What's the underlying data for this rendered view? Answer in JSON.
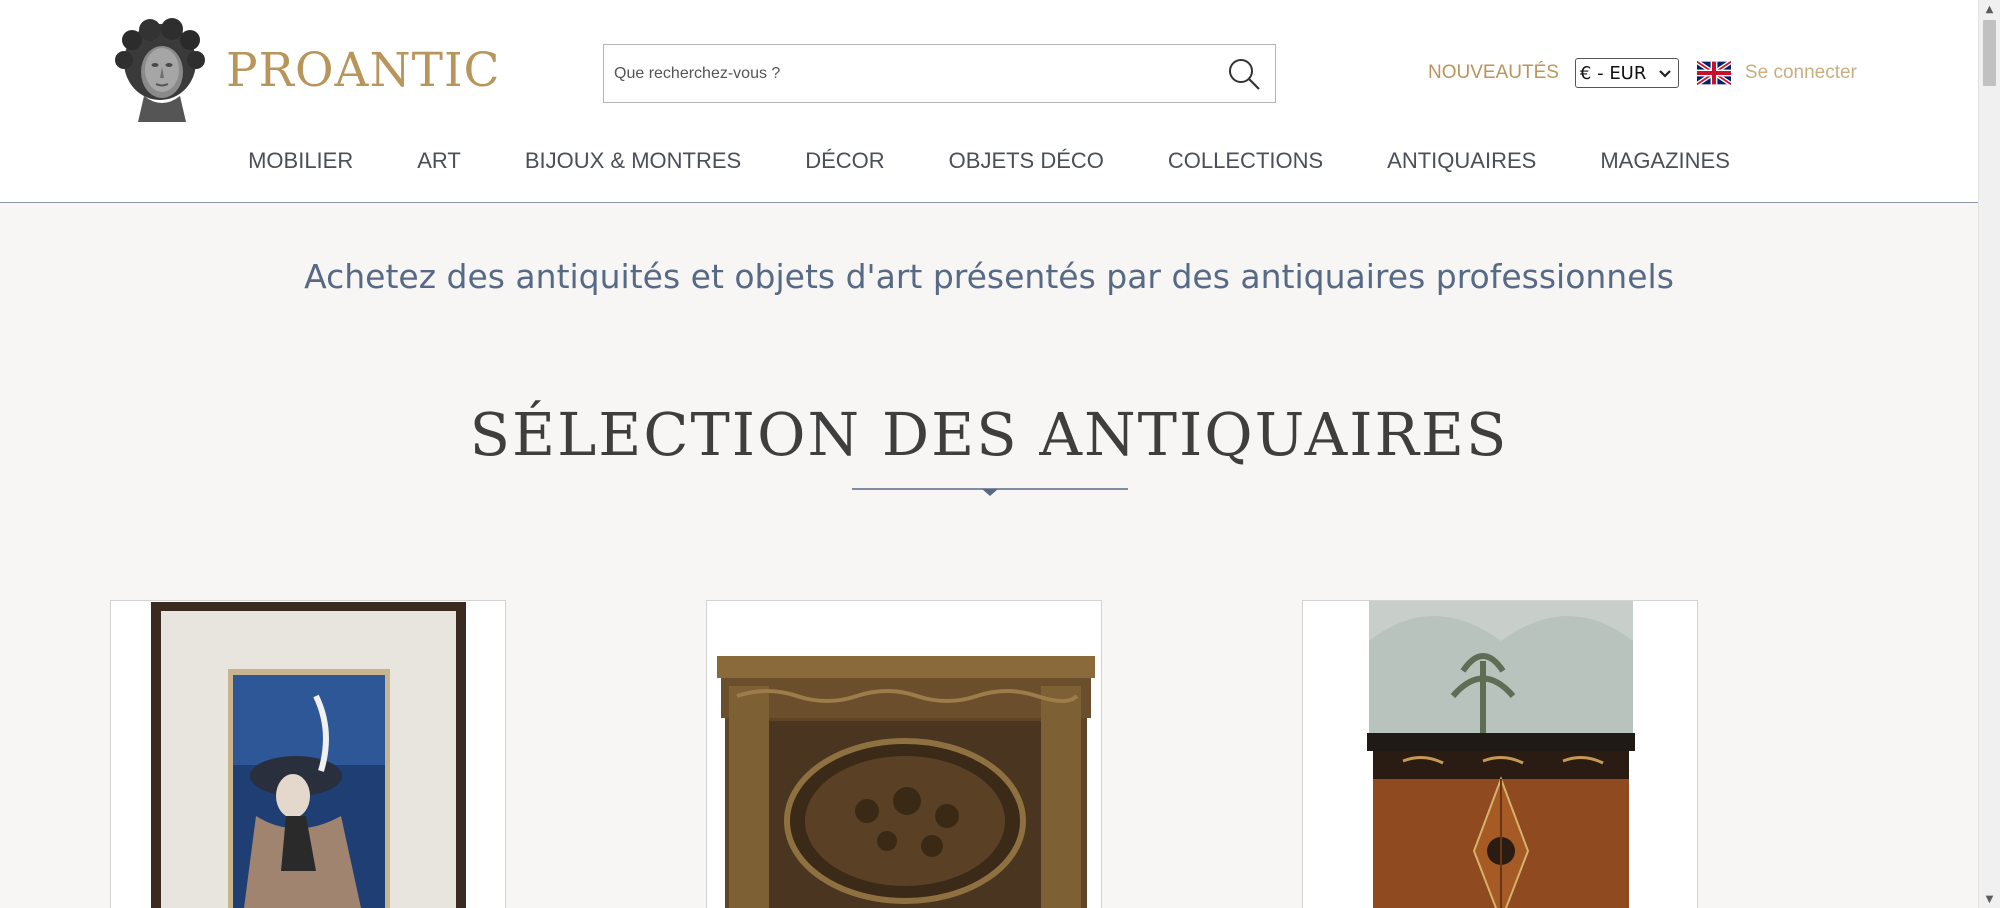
{
  "brand": {
    "name": "PROANTIC",
    "logo_icon": "classical-bust-icon"
  },
  "search": {
    "placeholder": "Que recherchez-vous ?",
    "icon": "search-icon"
  },
  "header_right": {
    "new_label": "NOUVEAUTÉS",
    "currency": {
      "selected": "€ - EUR"
    },
    "language_flag": "uk-flag-icon",
    "login_label": "Se connecter"
  },
  "nav": {
    "items": [
      {
        "label": "MOBILIER"
      },
      {
        "label": "ART"
      },
      {
        "label": "BIJOUX & MONTRES"
      },
      {
        "label": "DÉCOR"
      },
      {
        "label": "OBJETS DÉCO"
      },
      {
        "label": "COLLECTIONS"
      },
      {
        "label": "ANTIQUAIRES"
      },
      {
        "label": "MAGAZINES"
      }
    ]
  },
  "main": {
    "tagline": "Achetez des antiquités et objets d'art présentés par des antiquaires professionnels",
    "section_title": "SÉLECTION DES ANTIQUAIRES",
    "cards": [
      {
        "image": "framed-painting-woman-in-hat"
      },
      {
        "image": "carved-wooden-panel"
      },
      {
        "image": "inlaid-cabinet-with-mirror"
      }
    ]
  },
  "colors": {
    "brand_gold": "#b8955a",
    "login_gold": "#c9ae80",
    "tagline_blue": "#566a86",
    "nav_text": "#4a4f58",
    "page_bg": "#f7f6f5"
  }
}
